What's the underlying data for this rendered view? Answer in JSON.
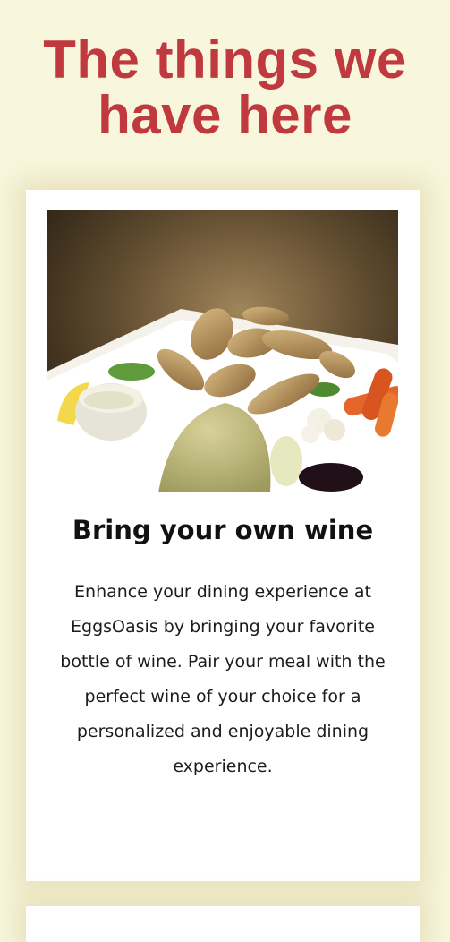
{
  "page": {
    "heading": "The things we have here",
    "background_color": "#f8f6dc",
    "accent_color": "#c0393f"
  },
  "card": {
    "image": "food-photo",
    "title": "Bring your own wine",
    "description": "Enhance your dining experience at EggsOasis by bringing your favorite bottle of wine. Pair your meal with the perfect wine of your choice for a personalized and enjoyable dining experience."
  }
}
